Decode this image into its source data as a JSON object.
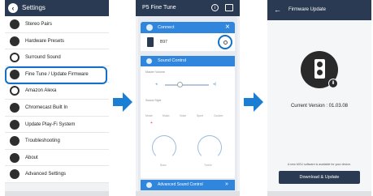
{
  "colors": {
    "header": "#2a3a52",
    "accent": "#1570c5",
    "bar": "#2f86dc",
    "arrow": "#1a7fd4"
  },
  "phone1": {
    "title": "Settings",
    "back_icon": "back-arrow-icon",
    "items": [
      {
        "label": "Stereo Pairs",
        "icon": "stereo-pairs-icon"
      },
      {
        "label": "Hardware Presets",
        "icon": "hardware-presets-icon"
      },
      {
        "label": "Surround Sound",
        "icon": "surround-sound-icon"
      },
      {
        "label": "Fine Tune / Update Firmware",
        "icon": "fine-tune-icon"
      },
      {
        "label": "Amazon Alexa",
        "icon": "amazon-alexa-icon"
      },
      {
        "label": "Chromecast Built In",
        "icon": "chromecast-icon"
      },
      {
        "label": "Update Play-Fi System",
        "icon": "update-icon"
      },
      {
        "label": "Troubleshooting",
        "icon": "troubleshooting-icon"
      },
      {
        "label": "About",
        "icon": "about-icon"
      },
      {
        "label": "Advanced Settings",
        "icon": "advanced-settings-icon"
      }
    ],
    "highlighted_index": 3
  },
  "phone2": {
    "title": "P5 Fine Tune",
    "connect": {
      "label": "Connect",
      "close": "×"
    },
    "device_name": "B97",
    "sound_control": {
      "label": "Sound Control",
      "master_volume_label": "Master Volume",
      "volume_level": 0.35,
      "sound_style_label": "Sound Style",
      "styles": [
        "Movie",
        "Music",
        "Voice",
        "Sport",
        "Custom"
      ],
      "dial_left_label": "Bass",
      "dial_right_label": "Treble"
    },
    "advanced_sound_control": {
      "label": "Advanced Sound Control",
      "chevron": "»"
    }
  },
  "phone3": {
    "title": "Firmware Update",
    "back": "←",
    "current_version_label": "Current Version : 01.03.08",
    "note": "A new MCU software is available for your device.",
    "button_label": "Download & Update"
  }
}
